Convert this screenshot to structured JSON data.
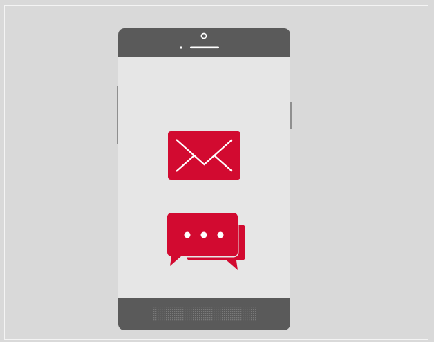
{
  "device": {
    "type": "smartphone",
    "body_color": "#5a5a5a",
    "screen_color": "#e6e6e6",
    "accent_color": "#d20a30",
    "background_color": "#d9d9d9"
  },
  "screen": {
    "icons": [
      {
        "name": "email-envelope-icon"
      },
      {
        "name": "chat-bubbles-icon"
      }
    ]
  }
}
